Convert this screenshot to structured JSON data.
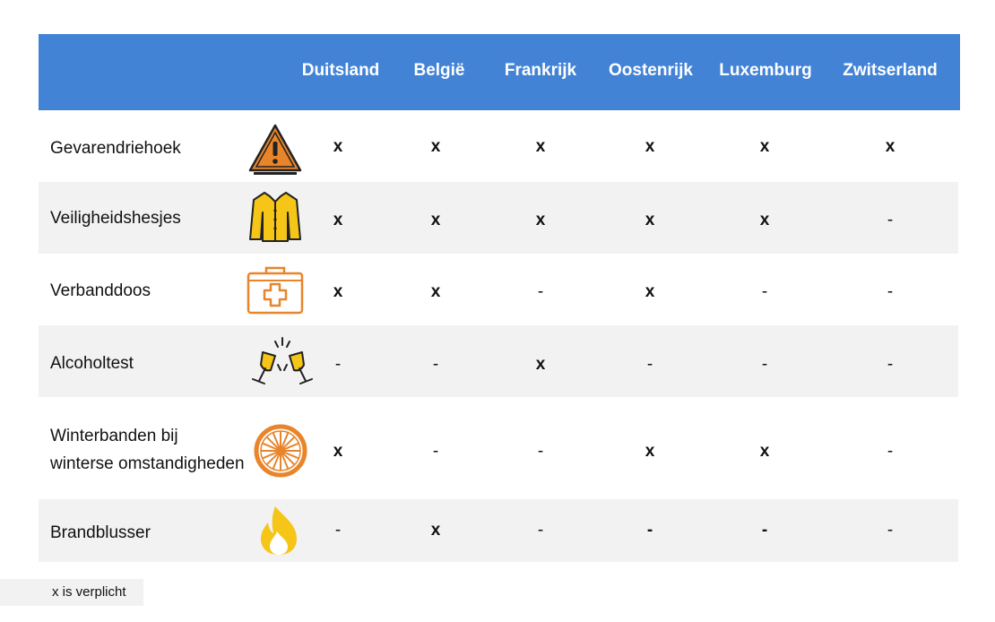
{
  "columns": [
    "Duitsland",
    "België",
    "Frankrijk",
    "Oostenrijk",
    "Luxemburg",
    "Zwitserland"
  ],
  "rows": [
    {
      "label": "Gevarendriehoek",
      "icon": "warning-triangle-icon",
      "values": [
        "x",
        "x",
        "x",
        "x",
        "x",
        "x"
      ]
    },
    {
      "label": "Veiligheidshesjes",
      "icon": "safety-vest-icon",
      "values": [
        "x",
        "x",
        "x",
        "x",
        "x",
        "-"
      ]
    },
    {
      "label": "Verbanddoos",
      "icon": "first-aid-kit-icon",
      "values": [
        "x",
        "x",
        "-",
        "x",
        "-",
        "-"
      ]
    },
    {
      "label": "Alcoholtest",
      "icon": "toasting-glasses-icon",
      "values": [
        "-",
        "-",
        "x",
        "-",
        "-",
        "-"
      ]
    },
    {
      "label_lines": [
        "Winterbanden bij",
        "winterse omstandigheden"
      ],
      "icon": "wheel-icon",
      "values": [
        "x",
        "-",
        "-",
        "x",
        "x",
        "-"
      ]
    },
    {
      "label": "Brandblusser",
      "icon": "flame-icon",
      "values": [
        "-",
        "x",
        "-",
        "-",
        "-",
        "-"
      ]
    }
  ],
  "legend": "x is verplicht",
  "colors": {
    "header_bg": "#4283d6",
    "row_shade": "#f2f2f2",
    "icon_orange": "#e8852b",
    "icon_yellow": "#f5c518"
  }
}
